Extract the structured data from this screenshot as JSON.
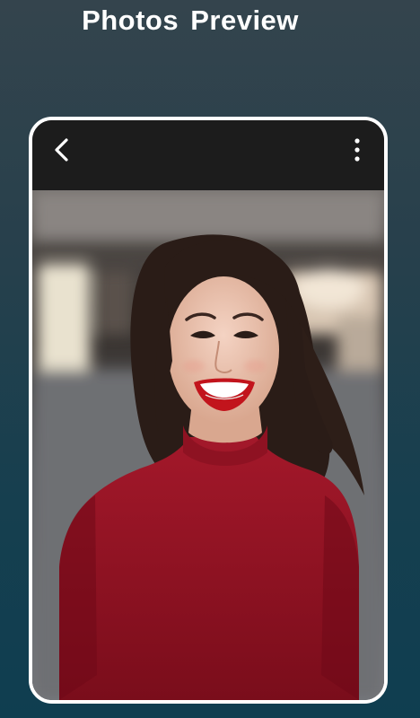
{
  "header": {
    "title": "Photos Preview"
  },
  "viewer": {
    "back_icon": "chevron-left-icon",
    "menu_icon": "more-vertical-icon",
    "photo_subject": "portrait"
  },
  "colors": {
    "background_top": "#34444d",
    "background_bottom": "#0f3e50",
    "frame_border": "#ffffff",
    "toolbar": "#1c1c1c",
    "top_garment": "#8e1222",
    "lips": "#c2141c"
  }
}
